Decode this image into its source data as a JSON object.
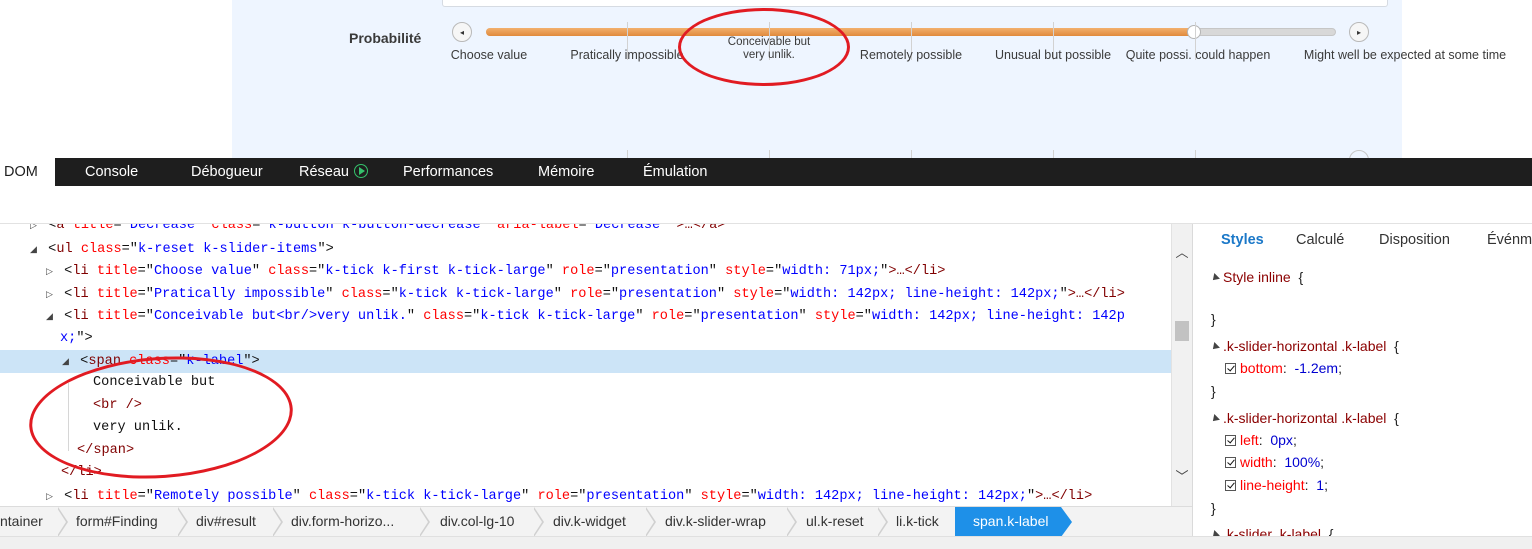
{
  "slider": {
    "label": "Probabilité",
    "decrease_glyph": "◂",
    "increase_glyph": "▸",
    "value_fraction": 0.833,
    "ticks": [
      {
        "label": "Choose value",
        "multi": false
      },
      {
        "label": "Pratically impossible",
        "multi": false
      },
      {
        "line1": "Conceivable but",
        "line2": "very unlik.",
        "multi": true
      },
      {
        "label": "Remotely possible",
        "multi": false
      },
      {
        "label": "Unusual but possible",
        "multi": false
      },
      {
        "label": "Quite possi. could happen",
        "multi": false
      },
      {
        "label": "Might well be expected at some time",
        "multi": false
      }
    ]
  },
  "devtools": {
    "tabs": {
      "dom": "DOM",
      "console": "Console",
      "debugger": "Débogueur",
      "network": "Réseau",
      "performance": "Performances",
      "memory": "Mémoire",
      "emulation": "Émulation"
    }
  },
  "dom": {
    "l0": {
      "tag": "a",
      "a1": "title",
      "v1": "Decrease",
      "a2": "class",
      "v2": "k-button k-button-decrease",
      "a3": "aria-label",
      "v3": "Decrease",
      "tail": ">…</a>"
    },
    "l1": {
      "tag": "ul",
      "a1": "class",
      "v1": "k-reset k-slider-items"
    },
    "l2": {
      "tag": "li",
      "a1": "title",
      "v1": "Choose value",
      "a2": "class",
      "v2": "k-tick k-first k-tick-large",
      "a3": "role",
      "v3": "presentation",
      "a4": "style",
      "v4": "width: 71px;",
      "tail": ">…</li>"
    },
    "l3": {
      "tag": "li",
      "a1": "title",
      "v1": "Pratically impossible",
      "a2": "class",
      "v2": "k-tick k-tick-large",
      "a3": "role",
      "v3": "presentation",
      "a4": "style",
      "v4": "width: 142px; line-height: 142px;",
      "tail": ">…</li>"
    },
    "l4": {
      "tag": "li",
      "a1": "title",
      "v1": "Conceivable but<br/>very unlik.",
      "a2": "class",
      "v2": "k-tick k-tick-large",
      "a3": "role",
      "v3": "presentation",
      "a4": "style",
      "v4a": "width: 142px; line-height: 142p",
      "v4b": "x;"
    },
    "l5": {
      "tag": "span",
      "a1": "class",
      "v1": "k-label"
    },
    "l6": "Conceivable but",
    "l7": "<br />",
    "l8": "very unlik.",
    "l9": "</span>",
    "l10": "</li>",
    "l11": {
      "tag": "li",
      "a1": "title",
      "v1": "Remotely possible",
      "a2": "class",
      "v2": "k-tick k-tick-large",
      "a3": "role",
      "v3": "presentation",
      "a4": "style",
      "v4": "width: 142px; line-height: 142px;",
      "tail": ">…</li>"
    }
  },
  "breadcrumb": [
    "ntainer",
    "form#Finding",
    "div#result",
    "div.form-horizo...",
    "div.col-lg-10",
    "div.k-widget",
    "div.k-slider-wrap",
    "ul.k-reset",
    "li.k-tick",
    "span.k-label"
  ],
  "styles": {
    "tabs": {
      "styles": "Styles",
      "computed": "Calculé",
      "layout": "Disposition",
      "events": "Événm"
    },
    "inline_label": "Style inline",
    "rules": [
      {
        "selector": ".k-slider-horizontal .k-label",
        "props": [
          {
            "name": "bottom",
            "value": "-1.2em"
          }
        ]
      },
      {
        "selector": ".k-slider-horizontal .k-label",
        "props": [
          {
            "name": "left",
            "value": "0px"
          },
          {
            "name": "width",
            "value": "100%"
          },
          {
            "name": "line-height",
            "value": "1"
          }
        ]
      },
      {
        "selector": ".k-slider .k-label"
      }
    ]
  },
  "colors": {
    "selection": "#e08a3c",
    "devtools_bar": "#1e1e1e",
    "annotation": "#e11b22",
    "breadcrumb_active": "#1e90e8"
  }
}
